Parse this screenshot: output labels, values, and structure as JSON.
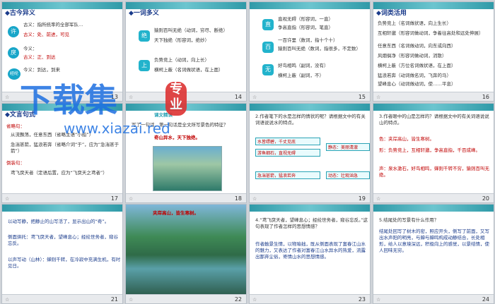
{
  "slides": [
    {
      "n": "13",
      "title": "◆古今异义",
      "lines": [
        "古义：指所统率的全部军队…",
        "今义：一个人的全部…",
        "古义：处、前进，可见",
        "今义：",
        "古义：正、到达",
        "今义：到达，到来"
      ],
      "chips": [
        "许",
        "戾",
        "经纶"
      ]
    },
    {
      "n": "14",
      "title": "◆一词多义",
      "lines": [
        "猿则百叫无绝（动词，穷尽、断绝）",
        "天下独绝（形容词，绝妙）",
        "负势竞上（动词，向上长）",
        "横柯上蔽（名词做状语，在上面）"
      ],
      "chips": [
        "绝",
        "上"
      ]
    },
    {
      "n": "15",
      "title": "",
      "lines": [
        "直视无碍（形容词，一直）",
        "争高直指（形容词，笔直）",
        "一百许里（数词，指十个十）",
        "猿则百叫无绝（数词，指很多，不定数）",
        "好鸟相鸣（副词，没有）",
        "横柯上蔽（副词，不）"
      ],
      "chips": [
        "直",
        "百",
        "无"
      ]
    },
    {
      "n": "16",
      "title": "◆词类活用",
      "lines": [
        "负势竞上（名词做状语，向上生长）",
        "互相轩邈（形容词做动词，争着往高处和远处伸展）",
        "任意东西（名词做动词，向东或向西）",
        "风烟俱净（形容词做动词，消散）",
        "横柯上蔽（方位名词做状语，在上面）",
        "猛浪若奔（动词做名词，飞奔的马）",
        "望峰息心（动词做动词，使……平息）"
      ]
    },
    {
      "n": "17",
      "title": "◆文言句式",
      "lines": [
        "省略句：",
        "从流飘荡，任意东西（省略主语“小船”）",
        "急湍甚箭，猛浪若奔（省略介词“于”，应为“急湍甚于箭”）",
        "倒装句：",
        "鸢飞戾天者（定语后置，应为“飞戾天之鸢者”）"
      ]
    },
    {
      "n": "18",
      "title": "",
      "lines": [
        "课文精读",
        "写了一句话，第一句话是全文所写景色的特征？",
        "奇山异水，天下独绝。"
      ]
    },
    {
      "n": "19",
      "title": "",
      "lines": [
        "2.作者笔下的水是怎样的情状的呢？请根据文中的有关词语说说水的特点。",
        "水皆缥碧，千丈见底",
        "游鱼细石，直视无碍",
        "急湍甚箭，猛浪若奔",
        "静态：美丽清澈",
        "动态：壮观汹急"
      ]
    },
    {
      "n": "20",
      "title": "",
      "lines": [
        "3.作者眼中的山是怎样的？请根据文中的有关词语说说山的特点。",
        "色：夹岸高山，皆生寒树。",
        "形：负势竞上，互相轩邈，争高直指，千百成峰。",
        "声：泉水激石，好鸟相鸣，蝉则千转不穷，猿则百叫无绝。"
      ]
    },
    {
      "n": "21",
      "title": "",
      "lines": [
        "以动写静，把静止的山写活了，显示出山的“奇”。",
        "侧面烘托：鸢飞戾天者，望峰息心；经纶世务者，窥谷忘反。",
        "以声写动（山林）：蝉则千转，在冷寂中充满生机，有时见日。"
      ]
    },
    {
      "n": "22",
      "title": "",
      "lines": [
        "夹岸高山，皆生寒树。"
      ]
    },
    {
      "n": "23",
      "title": "",
      "lines": [
        "4.“鸢飞戾天者，望峰息心；经纶世务者，窥谷忘反。”这句表现了作者怎样的思想情感？",
        "作者触景生情，以物喻拙，既从侧面表现了富春江山水的魅力，又表达了作者对富春江山水异水的热爱，流露出鄙弃尘俗，寄情山水的思想情感。"
      ]
    },
    {
      "n": "24",
      "title": "",
      "lines": [
        "5.结尾处的写景有什么作用？",
        "结尾处回写了树木的密，照应开头，侧写了前面，又写出水声阳的明亮，与蝉与蝉鸣构成动静结合，长处相形，给人以意境深远，积极向上的感觉，以景结情，使人回味无穷。"
      ]
    }
  ],
  "watermark": {
    "big": "下载集",
    "seal": "专业",
    "url": "www.xiazai.red"
  },
  "ui": {
    "star": "☆"
  }
}
